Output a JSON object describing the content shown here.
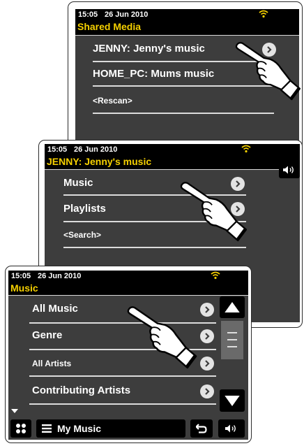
{
  "screens": [
    {
      "time": "15:05",
      "date": "26 Jun 2010",
      "title": "Shared Media",
      "items": [
        "JENNY: Jenny's music",
        "HOME_PC: Mums music",
        "<Rescan>"
      ]
    },
    {
      "time": "15:05",
      "date": "26 Jun 2010",
      "title": "JENNY: Jenny's music",
      "items": [
        "Music",
        "Playlists",
        "<Search>"
      ]
    },
    {
      "time": "15:05",
      "date": "26 Jun 2010",
      "title": "Music",
      "items": [
        "All Music",
        "Genre",
        "All Artists",
        "Contributing Artists"
      ],
      "bottom_bar": {
        "menu_label": "My Music"
      }
    }
  ],
  "icons": {
    "wifi": "wifi-icon",
    "chevron": "chevron-right-icon",
    "volume": "volume-icon",
    "home": "home-icon",
    "menu": "menu-icon",
    "back": "back-icon",
    "scroll_up": "scroll-up-icon",
    "scroll_down": "scroll-down-icon",
    "hand": "pointing-hand-icon"
  },
  "colors": {
    "title_text": "#f5d000",
    "wifi": "#f5d000",
    "screen_bg": "#3d3d3d",
    "bar_bg": "#000000"
  }
}
